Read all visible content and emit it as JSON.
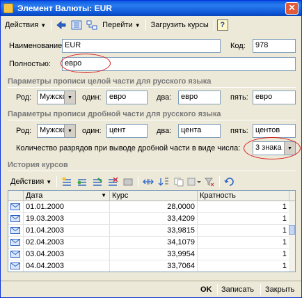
{
  "window": {
    "title": "Элемент Валюты: EUR",
    "close": "✕"
  },
  "toolbar": {
    "actions_label": "Действия",
    "goto_label": "Перейти",
    "load_rates_label": "Загрузить курсы",
    "help_label": "?"
  },
  "form": {
    "name_label": "Наименование:",
    "name_value": "EUR",
    "code_label": "Код:",
    "code_value": "978",
    "full_label": "Полностью:",
    "full_value": "евро"
  },
  "whole_section": {
    "title": "Параметры прописи целой части для русского языка",
    "gender_label": "Род:",
    "gender_value": "Мужской",
    "one_label": "один:",
    "one_value": "евро",
    "two_label": "два:",
    "two_value": "евро",
    "five_label": "пять:",
    "five_value": "евро"
  },
  "frac_section": {
    "title": "Параметры прописи дробной части для русского языка",
    "gender_label": "Род:",
    "gender_value": "Мужской",
    "one_label": "один:",
    "one_value": "цент",
    "two_label": "два:",
    "two_value": "цента",
    "five_label": "пять:",
    "five_value": "центов",
    "digits_label": "Количество разрядов при выводе дробной части в виде числа:",
    "digits_value": "3 знака"
  },
  "history": {
    "title": "История курсов",
    "actions_label": "Действия",
    "columns": [
      "Дата",
      "Курс",
      "Кратность"
    ],
    "rows": [
      {
        "date": "01.01.2000",
        "rate": "28,0000",
        "mult": "1"
      },
      {
        "date": "19.03.2003",
        "rate": "33,4209",
        "mult": "1"
      },
      {
        "date": "01.04.2003",
        "rate": "33,9815",
        "mult": "1"
      },
      {
        "date": "02.04.2003",
        "rate": "34,1079",
        "mult": "1"
      },
      {
        "date": "03.04.2003",
        "rate": "33,9954",
        "mult": "1"
      },
      {
        "date": "04.04.2003",
        "rate": "33,7064",
        "mult": "1"
      }
    ]
  },
  "bottom": {
    "ok": "OK",
    "save": "Записать",
    "close": "Закрыть"
  },
  "colors": {
    "title_blue": "#0a58e0",
    "highlight_red": "#d81e1e",
    "section_gray": "#7a7a7a"
  }
}
